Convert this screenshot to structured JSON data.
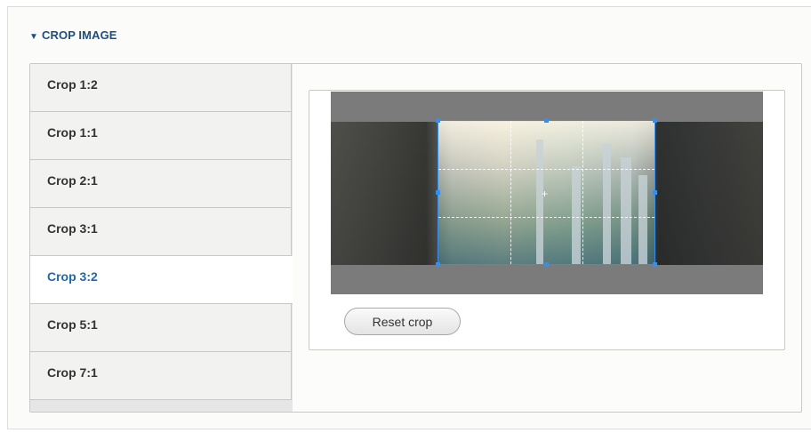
{
  "details": {
    "summary_icon": "triangle-down-icon",
    "summary_label": "CROP IMAGE"
  },
  "tabs": [
    {
      "label": "Crop 1:2",
      "active": false
    },
    {
      "label": "Crop 1:1",
      "active": false
    },
    {
      "label": "Crop 2:1",
      "active": false
    },
    {
      "label": "Crop 3:1",
      "active": false
    },
    {
      "label": "Crop 3:2",
      "active": true
    },
    {
      "label": "Crop 5:1",
      "active": false
    },
    {
      "label": "Crop 7:1",
      "active": false
    }
  ],
  "crop_pane": {
    "reset_label": "Reset crop",
    "selection_color": "#3a8ee6"
  },
  "colors": {
    "accent": "#1f68a8",
    "summary_text": "#1f4f7d"
  }
}
